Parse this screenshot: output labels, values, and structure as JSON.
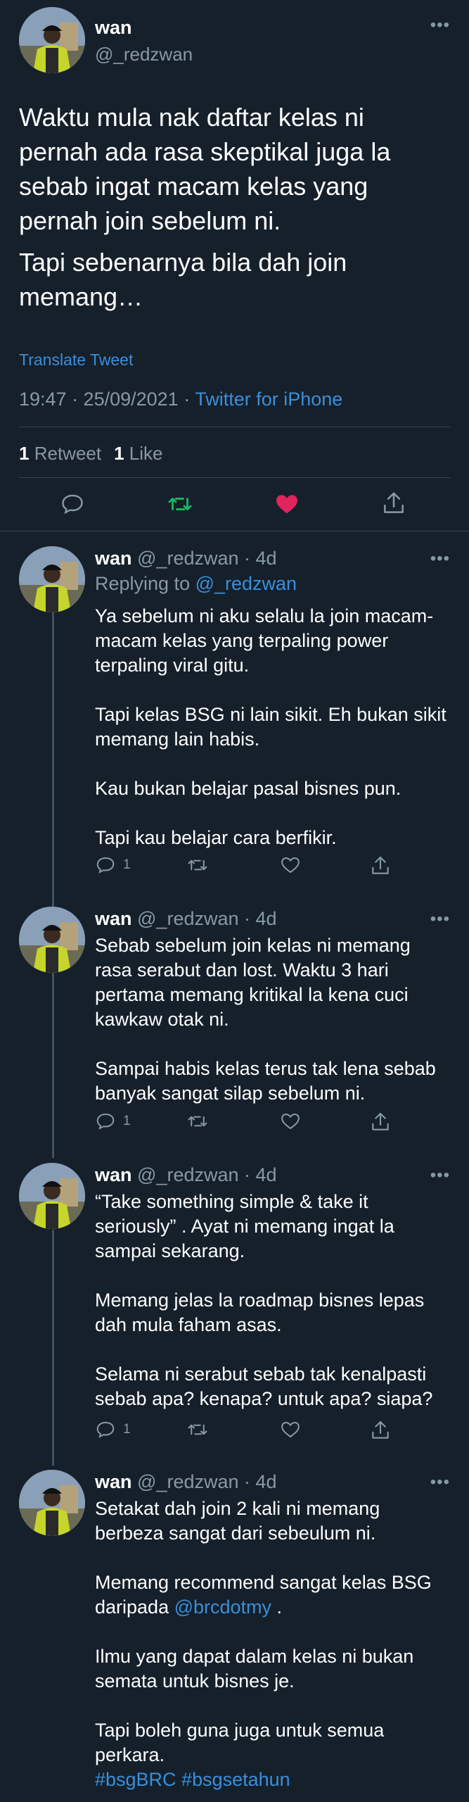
{
  "main_tweet": {
    "name": "wan",
    "handle": "@_redzwan",
    "more_glyph": "•••",
    "text_1": "Waktu mula nak daftar kelas ni pernah ada rasa skeptikal juga la sebab ingat macam kelas yang pernah join sebelum ni.",
    "text_2": "Tapi sebenarnya bila dah join memang…",
    "translate": "Translate Tweet",
    "timestamp": "19:47 · 25/09/2021 · ",
    "source": "Twitter for iPhone",
    "retweets_count": "1",
    "retweets_label": "Retweet",
    "likes_count": "1",
    "likes_label": "Like",
    "liked": true,
    "colors": {
      "retweet": "#17bf63",
      "like": "#e0245e",
      "link": "#3a8fd9",
      "muted": "#8899a6"
    }
  },
  "replies": [
    {
      "name": "wan",
      "meta": "@_redzwan · 4d",
      "replying_prefix": "Replying to ",
      "replying_handle": "@_redzwan",
      "paragraphs": [
        "Ya sebelum ni aku selalu la join macam-macam kelas yang terpaling power terpaling viral gitu.",
        "Tapi kelas BSG ni lain sikit. Eh bukan sikit memang lain habis.",
        "Kau bukan belajar pasal bisnes pun.",
        "Tapi kau belajar cara berfikir."
      ],
      "reply_count": "1"
    },
    {
      "name": "wan",
      "meta": "@_redzwan · 4d",
      "paragraphs": [
        "Sebab sebelum join kelas ni memang rasa serabut dan lost. Waktu 3 hari pertama memang kritikal la kena cuci kawkaw otak ni.",
        "Sampai habis kelas terus tak lena sebab banyak sangat silap sebelum ni."
      ],
      "reply_count": "1"
    },
    {
      "name": "wan",
      "meta": "@_redzwan · 4d",
      "paragraphs": [
        "“Take something simple & take it seriously” . Ayat ni memang ingat la sampai sekarang.",
        "Memang jelas la roadmap bisnes lepas dah mula faham asas.",
        "Selama ni serabut sebab tak kenalpasti sebab apa?  kenapa? untuk apa? siapa?"
      ],
      "reply_count": "1"
    },
    {
      "name": "wan",
      "meta": "@_redzwan · 4d",
      "p1": "Setakat dah join 2 kali ni memang berbeza sangat dari sebeulum ni.",
      "p2_prefix": "Memang recommend sangat kelas BSG daripada ",
      "p2_mention": "@brcdotmy",
      "p2_suffix": " .",
      "p3": "Ilmu yang dapat dalam kelas ni bukan semata untuk bisnes je.",
      "p4": "Tapi boleh guna juga untuk semua perkara.",
      "hashtags": "#bsgBRC #bsgsetahun"
    }
  ]
}
